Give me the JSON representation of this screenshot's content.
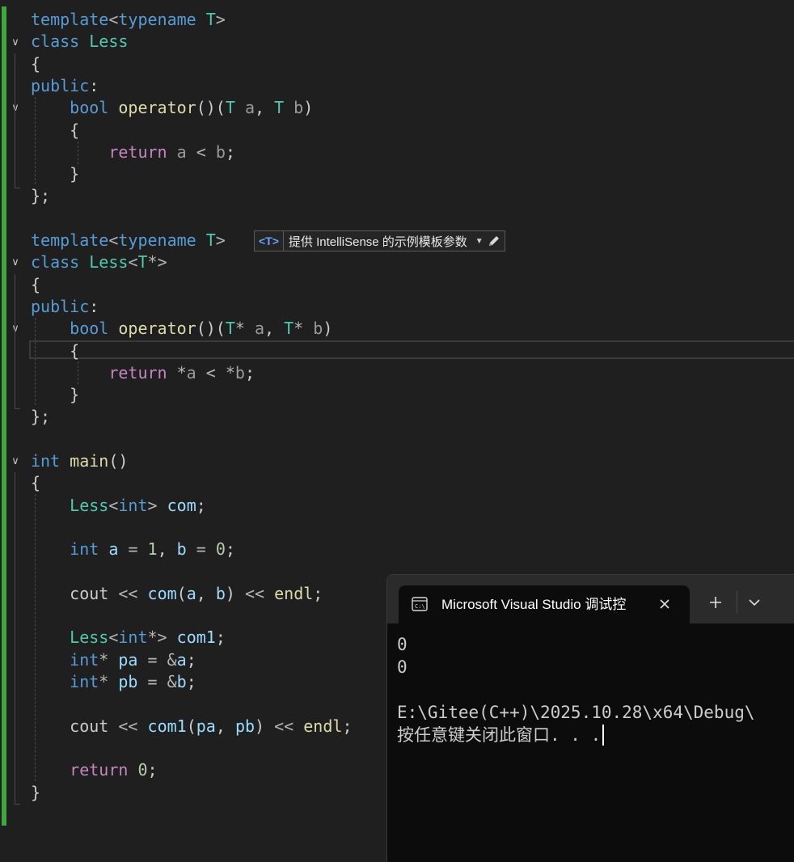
{
  "editor": {
    "lines": [
      [
        [
          "kw",
          "template"
        ],
        [
          "op",
          "<"
        ],
        [
          "kw",
          "typename"
        ],
        [
          "pl",
          " "
        ],
        [
          "tp",
          "T"
        ],
        [
          "op",
          ">"
        ]
      ],
      [
        [
          "kw",
          "class"
        ],
        [
          "pl",
          " "
        ],
        [
          "ty",
          "Less"
        ]
      ],
      [
        [
          "pl",
          "{"
        ]
      ],
      [
        [
          "kw",
          "public"
        ],
        [
          "pl",
          ":"
        ]
      ],
      [
        [
          "pl",
          "    "
        ],
        [
          "kw",
          "bool"
        ],
        [
          "pl",
          " "
        ],
        [
          "fn",
          "operator"
        ],
        [
          "pl",
          "()("
        ],
        [
          "tp",
          "T"
        ],
        [
          "pl",
          " "
        ],
        [
          "dim",
          "a"
        ],
        [
          "pl",
          ", "
        ],
        [
          "tp",
          "T"
        ],
        [
          "pl",
          " "
        ],
        [
          "dim",
          "b"
        ],
        [
          "pl",
          ")"
        ]
      ],
      [
        [
          "pl",
          "    {"
        ]
      ],
      [
        [
          "pl",
          "        "
        ],
        [
          "kw2",
          "return"
        ],
        [
          "pl",
          " "
        ],
        [
          "dim",
          "a"
        ],
        [
          "pl",
          " "
        ],
        [
          "op",
          "<"
        ],
        [
          "pl",
          " "
        ],
        [
          "dim",
          "b"
        ],
        [
          "pl",
          ";"
        ]
      ],
      [
        [
          "pl",
          "    }"
        ]
      ],
      [
        [
          "pl",
          "};"
        ]
      ],
      [],
      [
        [
          "kw",
          "template"
        ],
        [
          "op",
          "<"
        ],
        [
          "kw",
          "typename"
        ],
        [
          "pl",
          " "
        ],
        [
          "tp",
          "T"
        ],
        [
          "op",
          ">"
        ]
      ],
      [
        [
          "kw",
          "class"
        ],
        [
          "pl",
          " "
        ],
        [
          "ty",
          "Less"
        ],
        [
          "op",
          "<"
        ],
        [
          "tp",
          "T"
        ],
        [
          "op",
          "*>"
        ]
      ],
      [
        [
          "pl",
          "{"
        ]
      ],
      [
        [
          "kw",
          "public"
        ],
        [
          "pl",
          ":"
        ]
      ],
      [
        [
          "pl",
          "    "
        ],
        [
          "kw",
          "bool"
        ],
        [
          "pl",
          " "
        ],
        [
          "fn",
          "operator"
        ],
        [
          "pl",
          "()("
        ],
        [
          "tp",
          "T"
        ],
        [
          "op",
          "*"
        ],
        [
          "pl",
          " "
        ],
        [
          "dim",
          "a"
        ],
        [
          "pl",
          ", "
        ],
        [
          "tp",
          "T"
        ],
        [
          "op",
          "*"
        ],
        [
          "pl",
          " "
        ],
        [
          "dim",
          "b"
        ],
        [
          "pl",
          ")"
        ]
      ],
      [
        [
          "pl",
          "    {"
        ]
      ],
      [
        [
          "pl",
          "        "
        ],
        [
          "kw2",
          "return"
        ],
        [
          "pl",
          " "
        ],
        [
          "op",
          "*"
        ],
        [
          "dim",
          "a"
        ],
        [
          "pl",
          " "
        ],
        [
          "op",
          "<"
        ],
        [
          "pl",
          " "
        ],
        [
          "op",
          "*"
        ],
        [
          "dim",
          "b"
        ],
        [
          "pl",
          ";"
        ]
      ],
      [
        [
          "pl",
          "    }"
        ]
      ],
      [
        [
          "pl",
          "};"
        ]
      ],
      [],
      [
        [
          "kw",
          "int"
        ],
        [
          "pl",
          " "
        ],
        [
          "fn",
          "main"
        ],
        [
          "pl",
          "()"
        ]
      ],
      [
        [
          "pl",
          "{"
        ]
      ],
      [
        [
          "pl",
          "    "
        ],
        [
          "ty",
          "Less"
        ],
        [
          "op",
          "<"
        ],
        [
          "kw",
          "int"
        ],
        [
          "op",
          ">"
        ],
        [
          "pl",
          " "
        ],
        [
          "var",
          "com"
        ],
        [
          "pl",
          ";"
        ]
      ],
      [],
      [
        [
          "pl",
          "    "
        ],
        [
          "kw",
          "int"
        ],
        [
          "pl",
          " "
        ],
        [
          "var",
          "a"
        ],
        [
          "pl",
          " "
        ],
        [
          "op",
          "="
        ],
        [
          "pl",
          " "
        ],
        [
          "num",
          "1"
        ],
        [
          "pl",
          ", "
        ],
        [
          "var",
          "b"
        ],
        [
          "pl",
          " "
        ],
        [
          "op",
          "="
        ],
        [
          "pl",
          " "
        ],
        [
          "num",
          "0"
        ],
        [
          "pl",
          ";"
        ]
      ],
      [],
      [
        [
          "pl",
          "    "
        ],
        [
          "pl",
          "cout"
        ],
        [
          "pl",
          " "
        ],
        [
          "op",
          "<<"
        ],
        [
          "pl",
          " "
        ],
        [
          "var",
          "com"
        ],
        [
          "pl",
          "("
        ],
        [
          "var",
          "a"
        ],
        [
          "pl",
          ", "
        ],
        [
          "var",
          "b"
        ],
        [
          "pl",
          ") "
        ],
        [
          "op",
          "<<"
        ],
        [
          "pl",
          " "
        ],
        [
          "fn",
          "endl"
        ],
        [
          "pl",
          ";"
        ]
      ],
      [],
      [
        [
          "pl",
          "    "
        ],
        [
          "ty",
          "Less"
        ],
        [
          "op",
          "<"
        ],
        [
          "kw",
          "int"
        ],
        [
          "op",
          "*>"
        ],
        [
          "pl",
          " "
        ],
        [
          "var",
          "com1"
        ],
        [
          "pl",
          ";"
        ]
      ],
      [
        [
          "pl",
          "    "
        ],
        [
          "kw",
          "int"
        ],
        [
          "op",
          "*"
        ],
        [
          "pl",
          " "
        ],
        [
          "var",
          "pa"
        ],
        [
          "pl",
          " "
        ],
        [
          "op",
          "="
        ],
        [
          "pl",
          " "
        ],
        [
          "op",
          "&"
        ],
        [
          "var",
          "a"
        ],
        [
          "pl",
          ";"
        ]
      ],
      [
        [
          "pl",
          "    "
        ],
        [
          "kw",
          "int"
        ],
        [
          "op",
          "*"
        ],
        [
          "pl",
          " "
        ],
        [
          "var",
          "pb"
        ],
        [
          "pl",
          " "
        ],
        [
          "op",
          "="
        ],
        [
          "pl",
          " "
        ],
        [
          "op",
          "&"
        ],
        [
          "var",
          "b"
        ],
        [
          "pl",
          ";"
        ]
      ],
      [],
      [
        [
          "pl",
          "    "
        ],
        [
          "pl",
          "cout"
        ],
        [
          "pl",
          " "
        ],
        [
          "op",
          "<<"
        ],
        [
          "pl",
          " "
        ],
        [
          "var",
          "com1"
        ],
        [
          "pl",
          "("
        ],
        [
          "var",
          "pa"
        ],
        [
          "pl",
          ", "
        ],
        [
          "var",
          "pb"
        ],
        [
          "pl",
          ") "
        ],
        [
          "op",
          "<<"
        ],
        [
          "pl",
          " "
        ],
        [
          "fn",
          "endl"
        ],
        [
          "pl",
          ";"
        ]
      ],
      [],
      [
        [
          "pl",
          "    "
        ],
        [
          "kw2",
          "return"
        ],
        [
          "pl",
          " "
        ],
        [
          "num",
          "0"
        ],
        [
          "pl",
          ";"
        ]
      ],
      [
        [
          "pl",
          "}"
        ]
      ]
    ]
  },
  "hint": {
    "tag": "<T>",
    "text": "提供 IntelliSense 的示例模板参数"
  },
  "console": {
    "tab_title": "Microsoft Visual Studio 调试控",
    "output": [
      "0",
      "0",
      "",
      "E:\\Gitee(C++)\\2025.10.28\\x64\\Debug\\",
      "按任意键关闭此窗口. . ."
    ]
  },
  "colors": {
    "change_bar": "#3fa83c",
    "editor_bg": "#1f1f1f",
    "console_bg": "#0c0c0c"
  }
}
